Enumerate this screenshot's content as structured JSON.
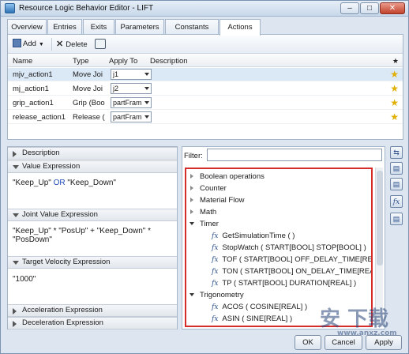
{
  "window": {
    "title": "Resource Logic Behavior Editor - LIFT",
    "controls": [
      "–",
      "□",
      "✕"
    ]
  },
  "tabs": [
    "Overview",
    "Entries",
    "Exits",
    "Parameters",
    "Constants",
    "Actions"
  ],
  "toolbar": {
    "add_label": "Add",
    "delete_label": "Delete"
  },
  "grid": {
    "columns": [
      "Name",
      "Type",
      "Apply To",
      "Description",
      "★"
    ],
    "rows": [
      {
        "name": "mjv_action1",
        "type": "Move Joi",
        "apply_to": "j1",
        "description": ""
      },
      {
        "name": "mj_action1",
        "type": "Move Joi",
        "apply_to": "j2",
        "description": ""
      },
      {
        "name": "grip_action1",
        "type": "Grip (Boo",
        "apply_to": "partFram",
        "description": ""
      },
      {
        "name": "release_action1",
        "type": "Release (",
        "apply_to": "partFram",
        "description": ""
      }
    ]
  },
  "left_panel": {
    "description_label": "Description",
    "value_expression": {
      "label": "Value Expression",
      "operand1": "\"Keep_Up\"",
      "op": "OR",
      "operand2": "\"Keep_Down\""
    },
    "joint_value_expression": {
      "label": "Joint Value Expression",
      "line1": "\"Keep_Up\" * \"PosUp\" + \"Keep_Down\" *",
      "line2": "\"PosDown\""
    },
    "target_velocity_expression": {
      "label": "Target Velocity Expression",
      "value": "\"1000\""
    },
    "acceleration_expression_label": "Acceleration Expression",
    "deceleration_expression_label": "Deceleration Expression"
  },
  "right_panel": {
    "filter_label": "Filter:",
    "filter_value": "",
    "tree": [
      {
        "label": "Boolean operations",
        "level": 0,
        "expanded": false
      },
      {
        "label": "Counter",
        "level": 0,
        "expanded": false
      },
      {
        "label": "Material Flow",
        "level": 0,
        "expanded": false
      },
      {
        "label": "Math",
        "level": 0,
        "expanded": false
      },
      {
        "label": "Timer",
        "level": 0,
        "expanded": true
      },
      {
        "label": "GetSimulationTime ( )",
        "level": 1,
        "fx": true
      },
      {
        "label": "StopWatch ( START[BOOL] STOP[BOOL] )",
        "level": 1,
        "fx": true
      },
      {
        "label": "TOF ( START[BOOL] OFF_DELAY_TIME[REAL] )",
        "level": 1,
        "fx": true
      },
      {
        "label": "TON ( START[BOOL] ON_DELAY_TIME[REAL] )",
        "level": 1,
        "fx": true
      },
      {
        "label": "TP ( START[BOOL] DURATION[REAL] )",
        "level": 1,
        "fx": true
      },
      {
        "label": "Trigonometry",
        "level": 0,
        "expanded": true
      },
      {
        "label": "ACOS ( COSINE[REAL] )",
        "level": 1,
        "fx": true
      },
      {
        "label": "ASIN ( SINE[REAL] )",
        "level": 1,
        "fx": true
      }
    ],
    "fx_glyph": "fx"
  },
  "footer": {
    "ok_label": "OK",
    "cancel_label": "Cancel",
    "apply_label": "Apply"
  },
  "watermark": {
    "line1": "安 下载",
    "line2": "www.anxz.com"
  },
  "colors": {
    "highlight_border": "#d62b2b",
    "star": "#e0b000",
    "selected_row": "#dbe8f6"
  }
}
